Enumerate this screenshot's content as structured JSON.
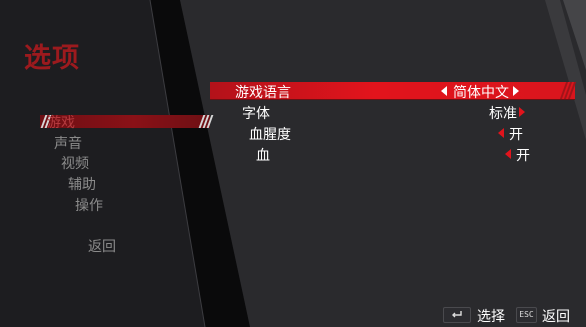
{
  "screen_title": "选项",
  "menu": {
    "items": [
      {
        "label": "游戏",
        "selected": true
      },
      {
        "label": "声音",
        "selected": false
      },
      {
        "label": "视频",
        "selected": false
      },
      {
        "label": "辅助",
        "selected": false
      },
      {
        "label": "操作",
        "selected": false
      }
    ],
    "back_label": "返回"
  },
  "options": [
    {
      "label": "游戏语言",
      "value": "简体中文",
      "arrow_left": true,
      "arrow_right": true,
      "highlighted": true
    },
    {
      "label": "字体",
      "value": "标准",
      "arrow_left": false,
      "arrow_right": true,
      "highlighted": false
    },
    {
      "label": "血腥度",
      "value": "开",
      "arrow_left": true,
      "arrow_right": false,
      "highlighted": false
    },
    {
      "label": "血",
      "value": "开",
      "arrow_left": true,
      "arrow_right": false,
      "highlighted": false
    }
  ],
  "footer": {
    "select_key_icon": "enter-key-icon",
    "select_label": "选择",
    "back_key_text": "ESC",
    "back_label": "返回"
  },
  "colors": {
    "accent": "#e2141c",
    "title": "#9c1a1e",
    "menu_highlight": "#8a1117",
    "inactive_text": "#8b8b8b"
  }
}
